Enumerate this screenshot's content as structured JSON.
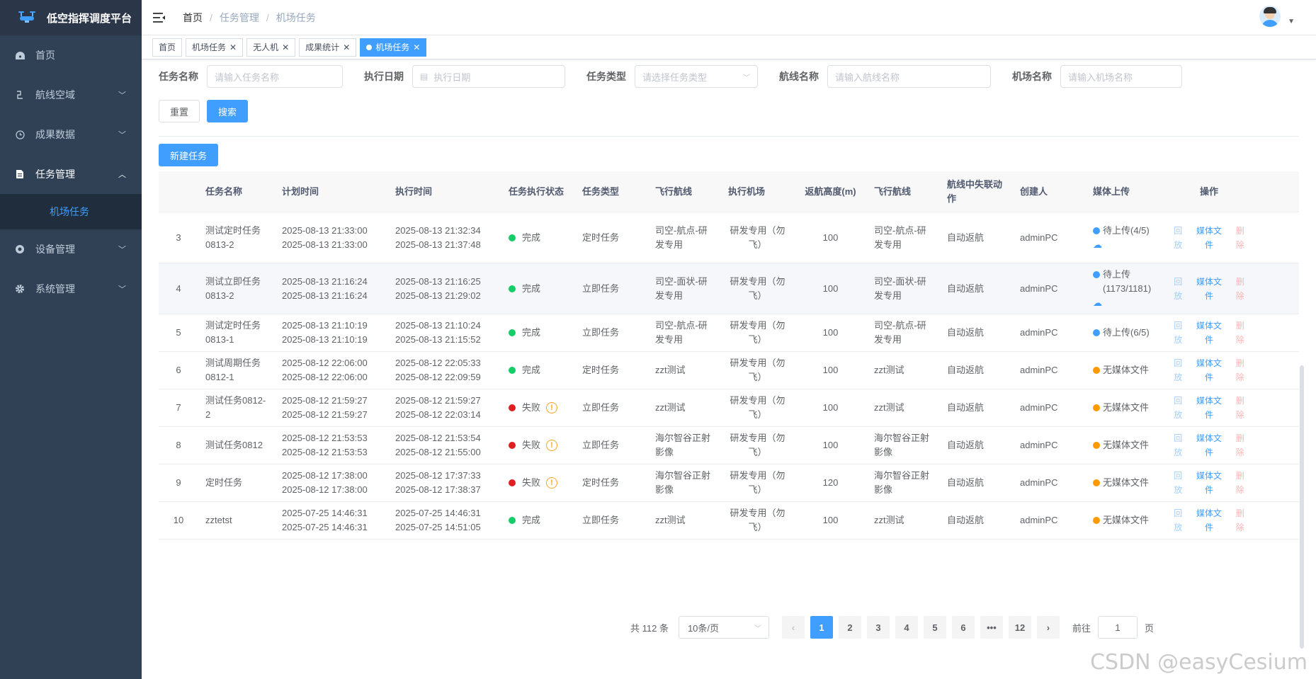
{
  "app": {
    "title": "低空指挥调度平台"
  },
  "sidebar": {
    "items": [
      {
        "label": "首页",
        "icon": "dashboard-icon",
        "chevron": ""
      },
      {
        "label": "航线空域",
        "icon": "route-icon",
        "chevron": "﹀"
      },
      {
        "label": "成果数据",
        "icon": "clock-icon",
        "chevron": "﹀"
      },
      {
        "label": "任务管理",
        "icon": "document-icon",
        "chevron": "︿"
      },
      {
        "label": "设备管理",
        "icon": "device-icon",
        "chevron": "﹀"
      },
      {
        "label": "系统管理",
        "icon": "gear-icon",
        "chevron": "﹀"
      }
    ],
    "sub_active": "机场任务"
  },
  "breadcrumb": {
    "home": "首页",
    "level1": "任务管理",
    "level2": "机场任务"
  },
  "tags": [
    {
      "label": "首页",
      "closable": false,
      "active": false
    },
    {
      "label": "机场任务",
      "closable": true,
      "active": false
    },
    {
      "label": "无人机",
      "closable": true,
      "active": false
    },
    {
      "label": "成果统计",
      "closable": true,
      "active": false
    },
    {
      "label": "机场任务",
      "closable": true,
      "active": true
    }
  ],
  "filters": {
    "task_name": {
      "label": "任务名称",
      "placeholder": "请输入任务名称"
    },
    "exec_date": {
      "label": "执行日期",
      "placeholder": "执行日期"
    },
    "task_type": {
      "label": "任务类型",
      "placeholder": "请选择任务类型"
    },
    "route_name": {
      "label": "航线名称",
      "placeholder": "请输入航线名称"
    },
    "airport_name": {
      "label": "机场名称",
      "placeholder": "请输入机场名称"
    }
  },
  "buttons": {
    "reset": "重置",
    "search": "搜索",
    "new_task": "新建任务"
  },
  "table": {
    "columns": [
      "",
      "任务名称",
      "计划时间",
      "执行时间",
      "任务执行状态",
      "任务类型",
      "飞行航线",
      "执行机场",
      "返航高度(m)",
      "飞行航线",
      "航线中失联动作",
      "创建人",
      "媒体上传",
      "操作"
    ],
    "ops": {
      "replay": "回放",
      "media": "媒体文件",
      "delete": "删除"
    },
    "rows": [
      {
        "no": "3",
        "name": "测试定时任务0813-2",
        "plan1": "2025-08-13 21:33:00",
        "plan2": "2025-08-13 21:33:00",
        "exec1": "2025-08-13 21:32:34",
        "exec2": "2025-08-13 21:37:48",
        "status": "完成",
        "status_color": "#13ce66",
        "warn": false,
        "type": "定时任务",
        "route": "司空-航点-研发专用",
        "airport": "研发专用（勿飞）",
        "height": "100",
        "route2": "司空-航点-研发专用",
        "lost": "自动返航",
        "creator": "adminPC",
        "media": "待上传(4/5)",
        "media_color": "#409eff",
        "upload": true
      },
      {
        "no": "4",
        "name": "测试立即任务0813-2",
        "plan1": "2025-08-13 21:16:24",
        "plan2": "2025-08-13 21:16:24",
        "exec1": "2025-08-13 21:16:25",
        "exec2": "2025-08-13 21:29:02",
        "status": "完成",
        "status_color": "#13ce66",
        "warn": false,
        "type": "立即任务",
        "route": "司空-面状-研发专用",
        "airport": "研发专用（勿飞）",
        "height": "100",
        "route2": "司空-面状-研发专用",
        "lost": "自动返航",
        "creator": "adminPC",
        "media": "待上传(1173/1181)",
        "media_color": "#409eff",
        "upload": true
      },
      {
        "no": "5",
        "name": "测试定时任务0813-1",
        "plan1": "2025-08-13 21:10:19",
        "plan2": "2025-08-13 21:10:19",
        "exec1": "2025-08-13 21:10:24",
        "exec2": "2025-08-13 21:15:52",
        "status": "完成",
        "status_color": "#13ce66",
        "warn": false,
        "type": "立即任务",
        "route": "司空-航点-研发专用",
        "airport": "研发专用（勿飞）",
        "height": "100",
        "route2": "司空-航点-研发专用",
        "lost": "自动返航",
        "creator": "adminPC",
        "media": "待上传(6/5)",
        "media_color": "#409eff",
        "upload": false
      },
      {
        "no": "6",
        "name": "测试周期任务0812-1",
        "plan1": "2025-08-12 22:06:00",
        "plan2": "2025-08-12 22:06:00",
        "exec1": "2025-08-12 22:05:33",
        "exec2": "2025-08-12 22:09:59",
        "status": "完成",
        "status_color": "#13ce66",
        "warn": false,
        "type": "定时任务",
        "route": "zzt测试",
        "airport": "研发专用（勿飞）",
        "height": "100",
        "route2": "zzt测试",
        "lost": "自动返航",
        "creator": "adminPC",
        "media": "无媒体文件",
        "media_color": "#ff9900",
        "upload": false
      },
      {
        "no": "7",
        "name": "测试任务0812-2",
        "plan1": "2025-08-12 21:59:27",
        "plan2": "2025-08-12 21:59:27",
        "exec1": "2025-08-12 21:59:27",
        "exec2": "2025-08-12 22:03:14",
        "status": "失败",
        "status_color": "#e02020",
        "warn": true,
        "type": "立即任务",
        "route": "zzt测试",
        "airport": "研发专用（勿飞）",
        "height": "100",
        "route2": "zzt测试",
        "lost": "自动返航",
        "creator": "adminPC",
        "media": "无媒体文件",
        "media_color": "#ff9900",
        "upload": false
      },
      {
        "no": "8",
        "name": "测试任务0812",
        "plan1": "2025-08-12 21:53:53",
        "plan2": "2025-08-12 21:53:53",
        "exec1": "2025-08-12 21:53:54",
        "exec2": "2025-08-12 21:55:00",
        "status": "失败",
        "status_color": "#e02020",
        "warn": true,
        "type": "立即任务",
        "route": "海尔智谷正射影像",
        "airport": "研发专用（勿飞）",
        "height": "100",
        "route2": "海尔智谷正射影像",
        "lost": "自动返航",
        "creator": "adminPC",
        "media": "无媒体文件",
        "media_color": "#ff9900",
        "upload": false
      },
      {
        "no": "9",
        "name": "定时任务",
        "plan1": "2025-08-12 17:38:00",
        "plan2": "2025-08-12 17:38:00",
        "exec1": "2025-08-12 17:37:33",
        "exec2": "2025-08-12 17:38:37",
        "status": "失败",
        "status_color": "#e02020",
        "warn": true,
        "type": "定时任务",
        "route": "海尔智谷正射影像",
        "airport": "研发专用（勿飞）",
        "height": "120",
        "route2": "海尔智谷正射影像",
        "lost": "自动返航",
        "creator": "adminPC",
        "media": "无媒体文件",
        "media_color": "#ff9900",
        "upload": false
      },
      {
        "no": "10",
        "name": "zztetst",
        "plan1": "2025-07-25 14:46:31",
        "plan2": "2025-07-25 14:46:31",
        "exec1": "2025-07-25 14:46:31",
        "exec2": "2025-07-25 14:51:05",
        "status": "完成",
        "status_color": "#13ce66",
        "warn": false,
        "type": "立即任务",
        "route": "zzt测试",
        "airport": "研发专用（勿飞）",
        "height": "100",
        "route2": "zzt测试",
        "lost": "自动返航",
        "creator": "adminPC",
        "media": "无媒体文件",
        "media_color": "#ff9900",
        "upload": false
      }
    ]
  },
  "pagination": {
    "total": "共 112 条",
    "page_size": "10条/页",
    "pages": [
      "1",
      "2",
      "3",
      "4",
      "5",
      "6",
      "•••",
      "12"
    ],
    "current": "1",
    "goto_label": "前往",
    "goto_value": "1",
    "goto_suffix": "页"
  },
  "watermark": "CSDN @easyCesium"
}
